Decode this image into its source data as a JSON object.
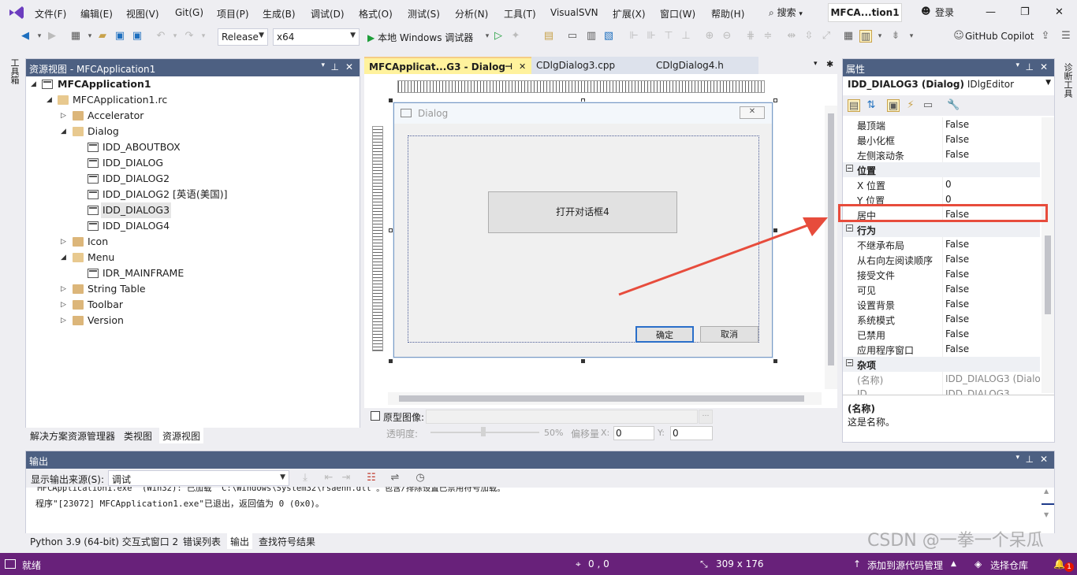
{
  "menubar": {
    "items": [
      "文件(F)",
      "编辑(E)",
      "视图(V)",
      "Git(G)",
      "项目(P)",
      "生成(B)",
      "调试(D)",
      "格式(O)",
      "测试(S)",
      "分析(N)",
      "工具(T)",
      "VisualSVN",
      "扩展(X)",
      "窗口(W)",
      "帮助(H)"
    ],
    "search": "搜索",
    "title_box": "MFCA...tion1",
    "login": "登录"
  },
  "toolbar": {
    "config": "Release",
    "platform": "x64",
    "run_label": "本地 Windows 调试器",
    "copilot": "GitHub Copilot"
  },
  "side": {
    "left_label": "工具箱",
    "right_label": "诊断工具"
  },
  "resource_view": {
    "title": "资源视图 - MFCApplication1",
    "root": "MFCApplication1",
    "rc": "MFCApplication1.rc",
    "nodes": [
      "Accelerator",
      "Dialog",
      "IDD_ABOUTBOX",
      "IDD_DIALOG",
      "IDD_DIALOG2",
      "IDD_DIALOG2 [英语(美国)]",
      "IDD_DIALOG3",
      "IDD_DIALOG4",
      "Icon",
      "Menu",
      "IDR_MAINFRAME",
      "String Table",
      "Toolbar",
      "Version"
    ],
    "tabs": [
      "解决方案资源管理器",
      "类视图",
      "资源视图"
    ]
  },
  "doc_tabs": [
    "MFCApplicat...G3 - Dialog",
    "CDlgDialog3.cpp",
    "CDlgDialog4.h"
  ],
  "dialog": {
    "title": "Dialog",
    "open_button": "打开对话框4",
    "ok": "确定",
    "cancel": "取消"
  },
  "editor_bottom": {
    "proto_label": "原型图像:",
    "opacity_label": "透明度:",
    "opacity_value": "50%",
    "offset_label": "偏移量",
    "x_label": "X:",
    "x_value": "0",
    "y_label": "Y:",
    "y_value": "0"
  },
  "properties": {
    "title": "属性",
    "object": "IDD_DIALOG3 (Dialog)",
    "editor": "IDlgEditor",
    "rows": [
      {
        "name": "最顶端",
        "value": "False",
        "cat": false
      },
      {
        "name": "最小化框",
        "value": "False",
        "cat": false
      },
      {
        "name": "左侧滚动条",
        "value": "False",
        "cat": false
      },
      {
        "name": "位置",
        "value": "",
        "cat": true
      },
      {
        "name": "X 位置",
        "value": "0",
        "cat": false
      },
      {
        "name": "Y 位置",
        "value": "0",
        "cat": false
      },
      {
        "name": "居中",
        "value": "False",
        "cat": false
      },
      {
        "name": "行为",
        "value": "",
        "cat": true
      },
      {
        "name": "不继承布局",
        "value": "False",
        "cat": false
      },
      {
        "name": "从右向左阅读顺序",
        "value": "False",
        "cat": false
      },
      {
        "name": "接受文件",
        "value": "False",
        "cat": false
      },
      {
        "name": "可见",
        "value": "False",
        "cat": false
      },
      {
        "name": "设置背景",
        "value": "False",
        "cat": false
      },
      {
        "name": "系统模式",
        "value": "False",
        "cat": false
      },
      {
        "name": "已禁用",
        "value": "False",
        "cat": false
      },
      {
        "name": "应用程序窗口",
        "value": "False",
        "cat": false
      },
      {
        "name": "杂项",
        "value": "",
        "cat": true
      },
      {
        "name": "(名称)",
        "value": "IDD_DIALOG3 (Dialo",
        "cat": false
      },
      {
        "name": "ID",
        "value": "IDD_DIALOG3",
        "cat": false
      }
    ],
    "desc_title": "(名称)",
    "desc_text": "这是名称。"
  },
  "output": {
    "title": "输出",
    "source_label": "显示输出来源(S):",
    "source_value": "调试",
    "line1": "\"MFCApplication1.exe\" (Win32): 已加载 \"C:\\Windows\\System32\\rsaenh.dll\"。包含/排除设置已禁用符号加载。",
    "line2": "程序\"[23072] MFCApplication1.exe\"已退出，返回值为 0 (0x0)。",
    "tabs": [
      "Python 3.9 (64-bit) 交互式窗口 2",
      "错误列表",
      "输出",
      "查找符号结果"
    ]
  },
  "status": {
    "ready": "就绪",
    "pos": "0 , 0",
    "size": "309 x 176",
    "scm": "添加到源代码管理",
    "repo": "选择仓库",
    "badge": "1"
  },
  "watermark": "CSDN @一拳一个呆瓜",
  "colors": {
    "accent": "#68217A",
    "panel_header": "#4D6082",
    "highlight": "#E74C3C"
  }
}
